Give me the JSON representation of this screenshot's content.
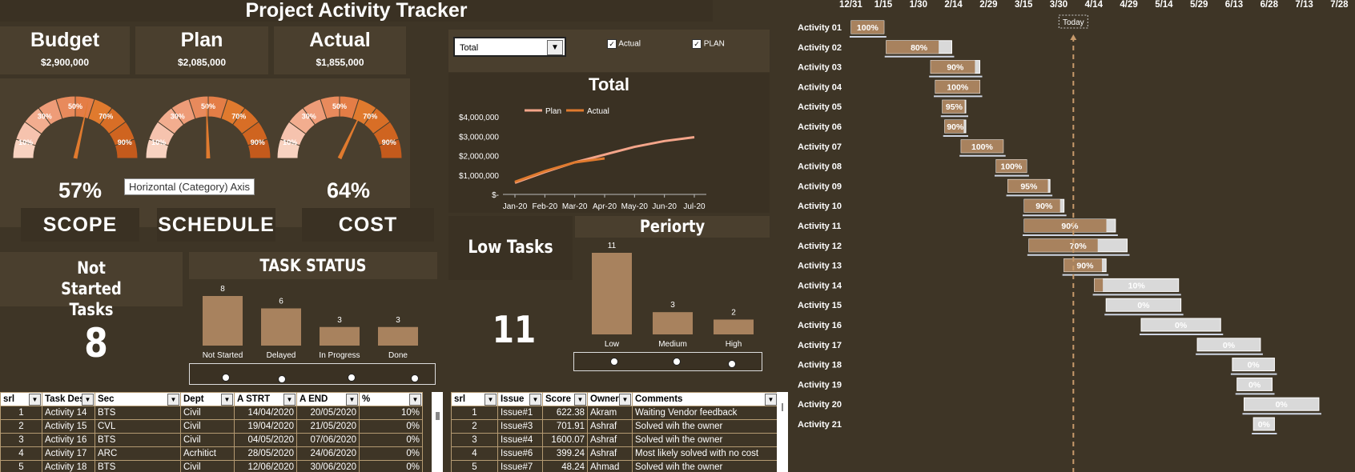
{
  "header": {
    "title": "Project Activity Tracker"
  },
  "kpis": [
    {
      "label": "Budget",
      "value": "$2,900,000"
    },
    {
      "label": "Plan",
      "value": "$2,085,000"
    },
    {
      "label": "Actual",
      "value": "$1,855,000"
    }
  ],
  "gauges": [
    {
      "name": "SCOPE",
      "percent": "57%",
      "value": 57,
      "ticks": [
        "10%",
        "30%",
        "50%",
        "70%",
        "90%"
      ]
    },
    {
      "name": "SCHEDULE",
      "percent": "",
      "value": 49,
      "ticks": [
        "10%",
        "30%",
        "50%",
        "70%",
        "90%"
      ]
    },
    {
      "name": "COST",
      "percent": "64%",
      "value": 64,
      "ticks": [
        "10%",
        "30%",
        "50%",
        "70%",
        "90%"
      ]
    }
  ],
  "tooltip": {
    "text": "Horizontal (Category) Axis"
  },
  "filter": {
    "selected": "Total",
    "check_actual": "Actual",
    "check_plan": "PLAN"
  },
  "colors": {
    "background": "#3e3526",
    "bar": "#a8825e",
    "actual_line": "#e07a2e",
    "plan_line": "#f4a58a",
    "gauge_light": "#f6c3ae",
    "gauge_dark": "#e07a2e"
  },
  "line_chart": {
    "title": "Total",
    "legend": [
      "Plan",
      "Actual"
    ],
    "y_ticks": [
      "$4,000,000",
      "$3,000,000",
      "$2,000,000",
      "$1,000,000",
      "$-"
    ],
    "x_ticks": [
      "Jan-20",
      "Feb-20",
      "Mar-20",
      "Apr-20",
      "May-20",
      "Jun-20",
      "Jul-20"
    ]
  },
  "chart_data": [
    {
      "type": "line",
      "title": "Total",
      "x": [
        "Jan-20",
        "Feb-20",
        "Mar-20",
        "Apr-20",
        "May-20",
        "Jun-20",
        "Jul-20"
      ],
      "ylim": [
        0,
        4000000
      ],
      "series": [
        {
          "name": "Plan",
          "values": [
            600000,
            1150000,
            1650000,
            2050000,
            2450000,
            2750000,
            2950000
          ]
        },
        {
          "name": "Actual",
          "values": [
            650000,
            1200000,
            1650000,
            1855000
          ]
        }
      ]
    },
    {
      "type": "bar",
      "title": "TASK STATUS",
      "categories": [
        "Not Started",
        "Delayed",
        "In Progress",
        "Done"
      ],
      "values": [
        8,
        6,
        3,
        3
      ]
    },
    {
      "type": "bar",
      "title": "Periorty",
      "categories": [
        "Low",
        "Medium",
        "High"
      ],
      "values": [
        11,
        3,
        2
      ]
    }
  ],
  "not_started": {
    "label": "Not Started Tasks",
    "count": "8"
  },
  "low_tasks": {
    "label": "Low Tasks",
    "count": "11"
  },
  "task_table": {
    "headers": [
      "srl",
      "Task Des",
      "Sec",
      "Dept",
      "A STRT",
      "A END",
      "%"
    ],
    "rows": [
      [
        "1",
        "Activity 14",
        "BTS",
        "Civil",
        "14/04/2020",
        "20/05/2020",
        "10%"
      ],
      [
        "2",
        "Activity 15",
        "CVL",
        "Civil",
        "19/04/2020",
        "21/05/2020",
        "0%"
      ],
      [
        "3",
        "Activity 16",
        "BTS",
        "Civil",
        "04/05/2020",
        "07/06/2020",
        "0%"
      ],
      [
        "4",
        "Activity 17",
        "ARC",
        "Acrhitict",
        "28/05/2020",
        "24/06/2020",
        "0%"
      ],
      [
        "5",
        "Activity 18",
        "BTS",
        "Civil",
        "12/06/2020",
        "30/06/2020",
        "0%"
      ]
    ]
  },
  "issue_table": {
    "headers": [
      "srl",
      "Issue",
      "Score",
      "Owner",
      "Comments"
    ],
    "rows": [
      [
        "1",
        "Issue#1",
        "622.38",
        "Akram",
        "Waiting Vendor feedback"
      ],
      [
        "2",
        "Issue#3",
        "701.91",
        "Ashraf",
        "Solved wih the owner"
      ],
      [
        "3",
        "Issue#4",
        "1600.07",
        "Ashraf",
        "Solved wih the owner"
      ],
      [
        "4",
        "Issue#6",
        "399.24",
        "Ashraf",
        "Most likely solved with no cost"
      ],
      [
        "5",
        "Issue#7",
        "48.24",
        "Ahmad",
        "Solved wih the owner"
      ]
    ]
  },
  "gantt": {
    "dates": [
      "12/31",
      "1/15",
      "1/30",
      "2/14",
      "2/29",
      "3/15",
      "3/30",
      "4/14",
      "4/29",
      "5/14",
      "5/29",
      "6/13",
      "6/28",
      "7/13",
      "7/28"
    ],
    "today_label": "Today",
    "today_day": 96,
    "activities": [
      {
        "label": "Activity 01",
        "start": 1,
        "end": 15,
        "pct": "100%",
        "p": 100
      },
      {
        "label": "Activity 02",
        "start": 16,
        "end": 44,
        "pct": "80%",
        "p": 80
      },
      {
        "label": "Activity 03",
        "start": 35,
        "end": 56,
        "pct": "90%",
        "p": 90
      },
      {
        "label": "Activity 04",
        "start": 37,
        "end": 56,
        "pct": "100%",
        "p": 100
      },
      {
        "label": "Activity 05",
        "start": 40,
        "end": 50,
        "pct": "95%",
        "p": 95
      },
      {
        "label": "Activity 06",
        "start": 41,
        "end": 50,
        "pct": "90%",
        "p": 90
      },
      {
        "label": "Activity 07",
        "start": 48,
        "end": 66,
        "pct": "100%",
        "p": 100
      },
      {
        "label": "Activity 08",
        "start": 63,
        "end": 76,
        "pct": "100%",
        "p": 100
      },
      {
        "label": "Activity 09",
        "start": 68,
        "end": 86,
        "pct": "95%",
        "p": 95
      },
      {
        "label": "Activity 10",
        "start": 75,
        "end": 92,
        "pct": "90%",
        "p": 90
      },
      {
        "label": "Activity 11",
        "start": 75,
        "end": 114,
        "pct": "90%",
        "p": 90
      },
      {
        "label": "Activity 12",
        "start": 77,
        "end": 119,
        "pct": "70%",
        "p": 70
      },
      {
        "label": "Activity 13",
        "start": 92,
        "end": 110,
        "pct": "90%",
        "p": 90
      },
      {
        "label": "Activity 14",
        "start": 105,
        "end": 141,
        "pct": "10%",
        "p": 10
      },
      {
        "label": "Activity 15",
        "start": 110,
        "end": 142,
        "pct": "0%",
        "p": 0
      },
      {
        "label": "Activity 16",
        "start": 125,
        "end": 159,
        "pct": "0%",
        "p": 0
      },
      {
        "label": "Activity 17",
        "start": 149,
        "end": 176,
        "pct": "0%",
        "p": 0
      },
      {
        "label": "Activity 18",
        "start": 164,
        "end": 182,
        "pct": "0%",
        "p": 0
      },
      {
        "label": "Activity 19",
        "start": 166,
        "end": 181,
        "pct": "0%",
        "p": 0
      },
      {
        "label": "Activity 20",
        "start": 169,
        "end": 201,
        "pct": "0%",
        "p": 0
      },
      {
        "label": "Activity 21",
        "start": 173,
        "end": 182,
        "pct": "0%",
        "p": 0
      }
    ]
  }
}
